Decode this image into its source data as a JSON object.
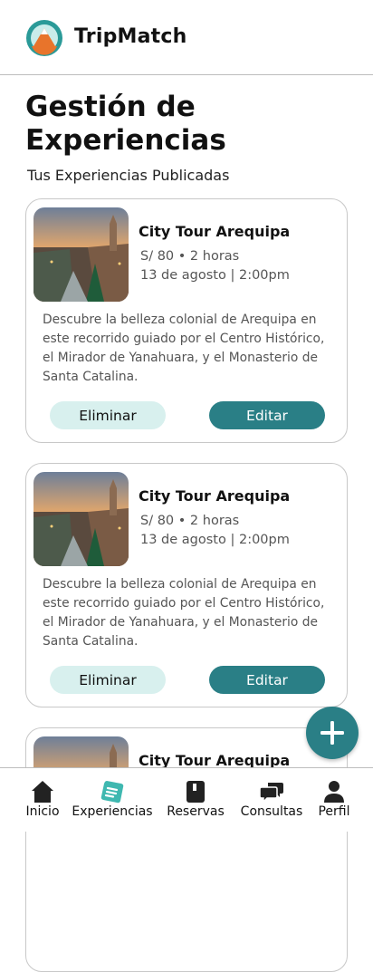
{
  "app": {
    "title": "TripMatch"
  },
  "page": {
    "title": "Gestión de Experiencias",
    "subtitle": "Tus Experiencias Publicadas"
  },
  "cards": [
    {
      "title": "City Tour Arequipa",
      "price_duration": "S/ 80 • 2 horas",
      "date_time": "13 de agosto | 2:00pm",
      "description": "Descubre la belleza colonial de Arequipa en este recorrido guiado por el Centro Histórico, el Mirador de Yanahuara, y el Monasterio de Santa Catalina.",
      "delete_label": "Eliminar",
      "edit_label": "Editar"
    },
    {
      "title": "City Tour Arequipa",
      "price_duration": "S/ 80 • 2 horas",
      "date_time": "13 de agosto | 2:00pm",
      "description": "Descubre la belleza colonial de Arequipa en este recorrido guiado por el Centro Histórico, el Mirador de Yanahuara, y el Monasterio de Santa Catalina.",
      "delete_label": "Eliminar",
      "edit_label": "Editar"
    },
    {
      "title": "City Tour Arequipa"
    }
  ],
  "fab": {
    "icon": "plus-icon"
  },
  "bottom_nav": {
    "items": [
      {
        "label": "Inicio",
        "icon": "home-icon"
      },
      {
        "label": "Experiencias",
        "icon": "experiences-icon",
        "active": true
      },
      {
        "label": "Reservas",
        "icon": "book-icon"
      },
      {
        "label": "Consultas",
        "icon": "chat-icon"
      },
      {
        "label": "Perfil",
        "icon": "user-icon"
      }
    ]
  },
  "colors": {
    "accent": "#2a7f86",
    "accent_light": "#d8f0ee",
    "active_icon": "#3fb8b0"
  }
}
